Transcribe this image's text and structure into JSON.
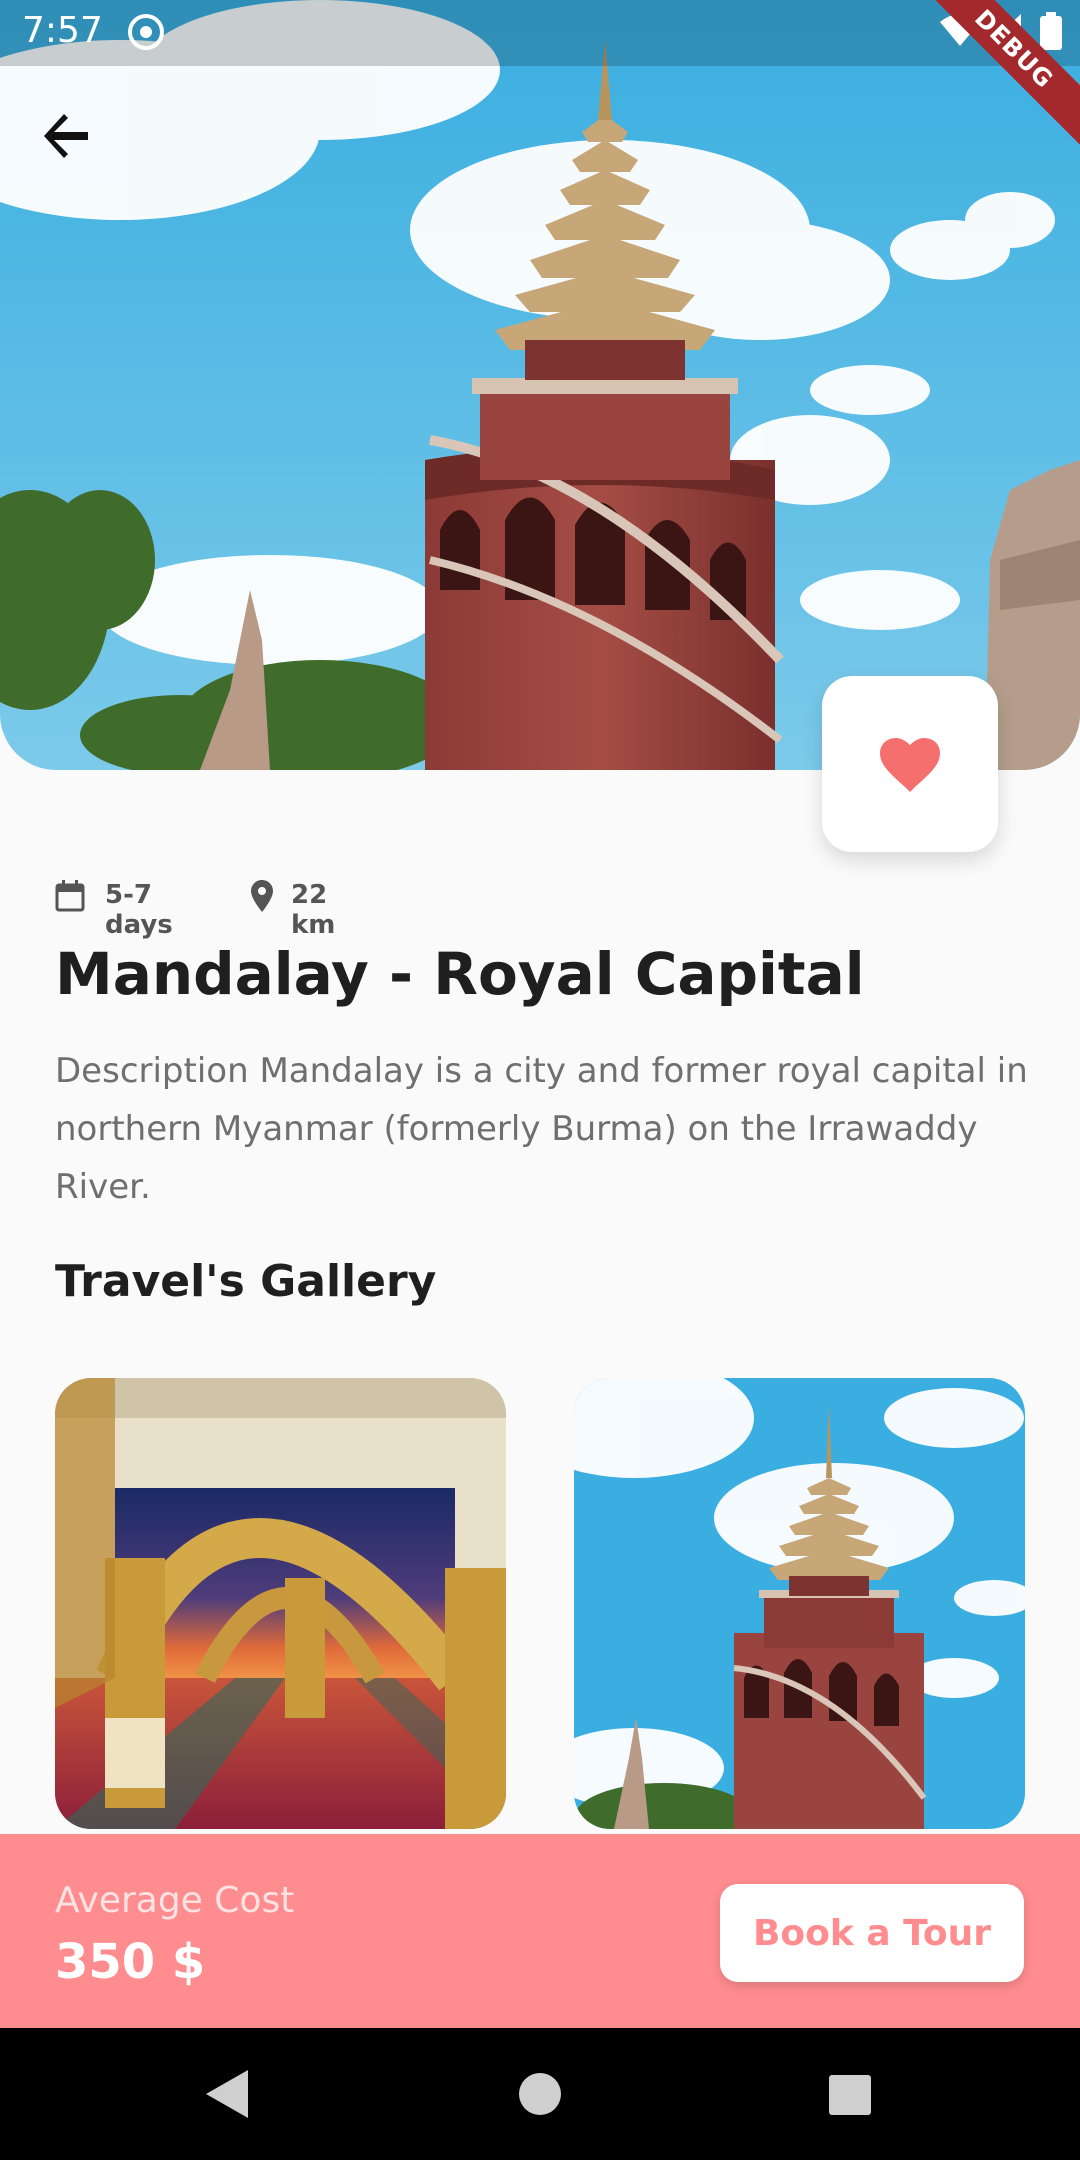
{
  "status_bar": {
    "time": "7:57",
    "icons": [
      "settings-icon",
      "wifi-icon",
      "signal-icon",
      "battery-icon"
    ]
  },
  "debug_banner": "DEBUG",
  "header": {
    "back_icon": "arrow-left-icon",
    "favorite_icon": "heart-icon"
  },
  "trip": {
    "duration": "5-7 days",
    "distance": "22 km",
    "title": "Mandalay - Royal Capital",
    "description": "Description Mandalay is a city and former royal capital in northern Myanmar (formerly Burma) on the Irrawaddy River."
  },
  "gallery": {
    "title": "Travel's Gallery"
  },
  "footer": {
    "cost_label": "Average Cost",
    "cost_value": "350 $",
    "book_button": "Book a Tour"
  },
  "navigation": {
    "icons": [
      "nav-back-icon",
      "nav-home-icon",
      "nav-recents-icon"
    ]
  },
  "colors": {
    "accent": "#ff8c8e",
    "heart": "#f66f6f",
    "background": "#fafafa",
    "title": "#1f1f1f",
    "description": "#6f6f6f"
  }
}
